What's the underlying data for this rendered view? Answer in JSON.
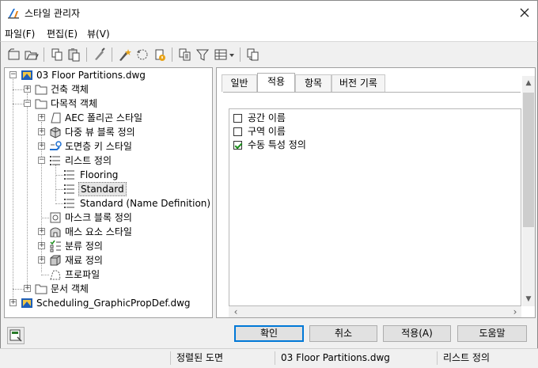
{
  "window": {
    "title": "스타일 관리자"
  },
  "menu": [
    {
      "label": "파일",
      "accel": "(F)"
    },
    {
      "label": "편집",
      "accel": "(E)"
    },
    {
      "label": "뷰",
      "accel": "(V)"
    }
  ],
  "toolbar": {
    "icons": [
      "new-drawing-icon",
      "open-drawing-icon",
      "copy-icon",
      "paste-icon",
      "purge-icon",
      "edit-style-icon",
      "sync-icon",
      "version-icon",
      "toggle-view-icon",
      "filter-icon",
      "view-options-icon",
      "inline-edit-icon"
    ]
  },
  "tree": {
    "items": [
      {
        "label": "03 Floor Partitions.dwg",
        "icon": "drawing-icon"
      },
      {
        "label": "건축 객체",
        "icon": "folder-icon"
      },
      {
        "label": "다목적 객체",
        "icon": "folder-icon"
      },
      {
        "label": "AEC 폴리곤 스타일",
        "icon": "polygon-style-icon"
      },
      {
        "label": "다중 뷰 블록 정의",
        "icon": "multiview-block-icon"
      },
      {
        "label": "도면층 키 스타일",
        "icon": "layer-key-icon"
      },
      {
        "label": "리스트 정의",
        "icon": "list-definition-icon"
      },
      {
        "label": "Flooring",
        "icon": "list-item-icon"
      },
      {
        "label": "Standard",
        "icon": "list-item-icon"
      },
      {
        "label": "Standard (Name Definition)",
        "icon": "list-item-icon"
      },
      {
        "label": "마스크 블록 정의",
        "icon": "mask-block-icon"
      },
      {
        "label": "매스 요소 스타일",
        "icon": "mass-element-icon"
      },
      {
        "label": "분류 정의",
        "icon": "classification-icon"
      },
      {
        "label": "재료 정의",
        "icon": "material-icon"
      },
      {
        "label": "프로파일",
        "icon": "profile-icon"
      },
      {
        "label": "문서 객체",
        "icon": "folder-icon"
      },
      {
        "label": "Scheduling_GraphicPropDef.dwg",
        "icon": "drawing-icon"
      }
    ],
    "selected": "Standard"
  },
  "tabs": [
    {
      "label": "일반"
    },
    {
      "label": "적용"
    },
    {
      "label": "항목"
    },
    {
      "label": "버전 기록"
    }
  ],
  "active_tab": "적용",
  "apply_options": [
    {
      "label": "공간 이름",
      "checked": false
    },
    {
      "label": "구역 이름",
      "checked": false
    },
    {
      "label": "수동 특성 정의",
      "checked": true
    }
  ],
  "buttons": {
    "ok": "확인",
    "cancel": "취소",
    "apply": "적용(A)",
    "help": "도움말"
  },
  "status": {
    "sort": "정렬된 도면",
    "drawing": "03 Floor Partitions.dwg",
    "type": "리스트 정의"
  },
  "colors": {
    "accent": "#0078d7",
    "check": "#1b8e1b"
  }
}
